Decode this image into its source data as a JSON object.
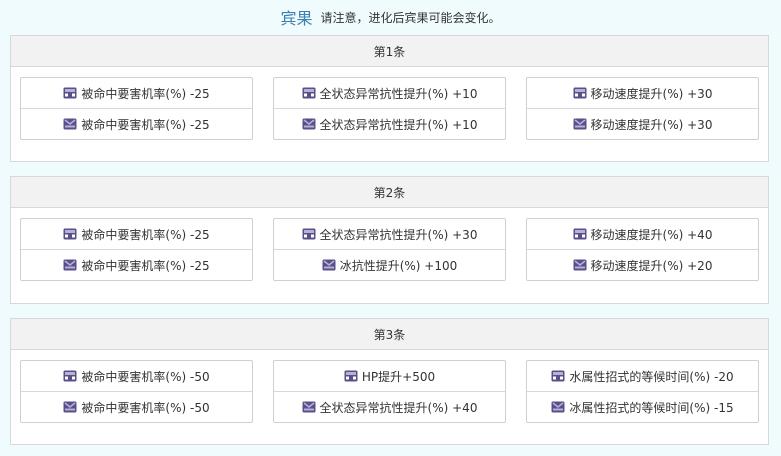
{
  "header": {
    "title": "宾果",
    "note": "请注意，进化后宾果可能会变化。"
  },
  "colors": {
    "accent": "#3c7fb1",
    "icon_body": "#5b4f8a",
    "icon_light": "#b7b0d8"
  },
  "sections": [
    {
      "title": "第1条",
      "cards": [
        {
          "rows": [
            {
              "icon": "crate-closed-icon",
              "text": "被命中要害机率(%) -25"
            },
            {
              "icon": "crate-open-icon",
              "text": "被命中要害机率(%) -25"
            }
          ]
        },
        {
          "rows": [
            {
              "icon": "crate-closed-icon",
              "text": "全状态异常抗性提升(%) +10"
            },
            {
              "icon": "crate-open-icon",
              "text": "全状态异常抗性提升(%) +10"
            }
          ]
        },
        {
          "rows": [
            {
              "icon": "crate-closed-icon",
              "text": "移动速度提升(%) +30"
            },
            {
              "icon": "crate-open-icon",
              "text": "移动速度提升(%) +30"
            }
          ]
        }
      ]
    },
    {
      "title": "第2条",
      "cards": [
        {
          "rows": [
            {
              "icon": "crate-closed-icon",
              "text": "被命中要害机率(%) -25"
            },
            {
              "icon": "crate-open-icon",
              "text": "被命中要害机率(%) -25"
            }
          ]
        },
        {
          "rows": [
            {
              "icon": "crate-closed-icon",
              "text": "全状态异常抗性提升(%) +30"
            },
            {
              "icon": "crate-open-icon",
              "text": "冰抗性提升(%) +100"
            }
          ]
        },
        {
          "rows": [
            {
              "icon": "crate-closed-icon",
              "text": "移动速度提升(%) +40"
            },
            {
              "icon": "crate-open-icon",
              "text": "移动速度提升(%) +20"
            }
          ]
        }
      ]
    },
    {
      "title": "第3条",
      "cards": [
        {
          "rows": [
            {
              "icon": "crate-closed-icon",
              "text": "被命中要害机率(%) -50"
            },
            {
              "icon": "crate-open-icon",
              "text": "被命中要害机率(%) -50"
            }
          ]
        },
        {
          "rows": [
            {
              "icon": "crate-closed-icon",
              "text": "HP提升+500"
            },
            {
              "icon": "crate-open-icon",
              "text": "全状态异常抗性提升(%) +40"
            }
          ]
        },
        {
          "rows": [
            {
              "icon": "crate-closed-icon",
              "text": "水属性招式的等候时间(%) -20"
            },
            {
              "icon": "crate-open-icon",
              "text": "冰属性招式的等候时间(%) -15"
            }
          ]
        }
      ]
    }
  ]
}
